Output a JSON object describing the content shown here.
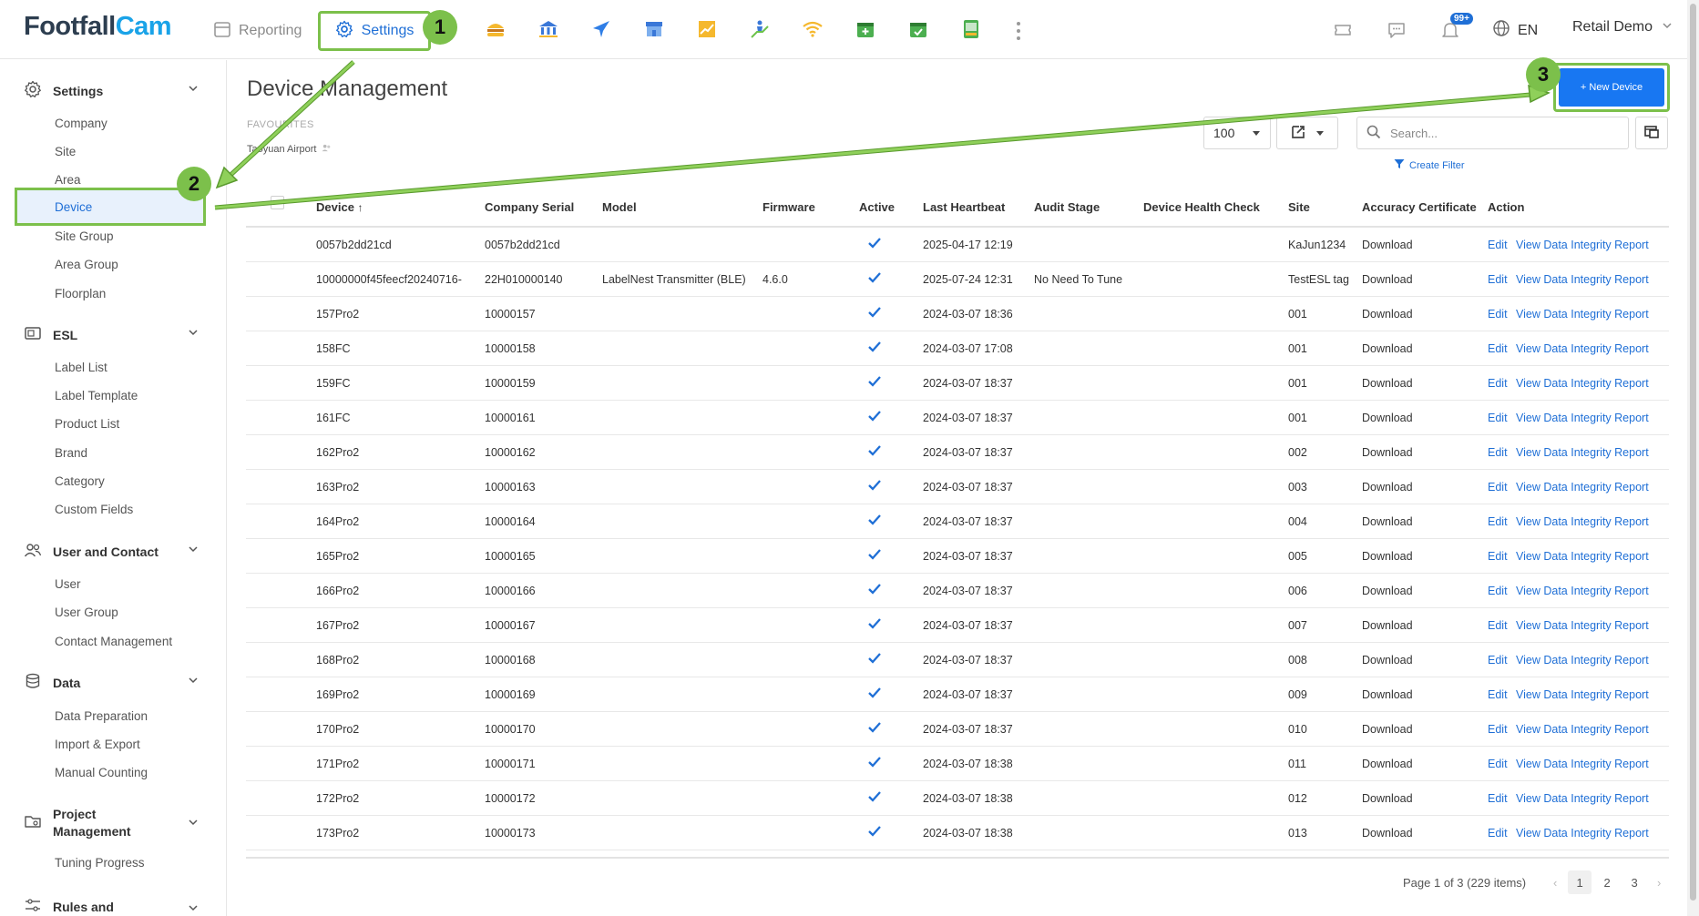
{
  "app": {
    "logo_part1": "Footfall",
    "logo_part2": "Cam"
  },
  "topnav": {
    "reporting_label": "Reporting",
    "settings_label": "Settings",
    "module_icons": [
      "burger-icon",
      "bank-icon",
      "plane-icon",
      "store-icon",
      "growth-chart-icon",
      "escalator-icon",
      "wifi-icon",
      "calendar-add-icon",
      "calendar-check-icon",
      "device-screen-icon"
    ],
    "notification_count": "99+",
    "language": "EN",
    "user_name": "Retail Demo"
  },
  "sidebar": {
    "sections": [
      {
        "label": "Settings",
        "items": [
          "Company",
          "Site",
          "Area",
          "Device",
          "Site Group",
          "Area Group",
          "Floorplan"
        ]
      },
      {
        "label": "ESL",
        "items": [
          "Label List",
          "Label Template",
          "Product List",
          "Brand",
          "Category",
          "Custom Fields"
        ]
      },
      {
        "label": "User and Contact",
        "items": [
          "User",
          "User Group",
          "Contact Management"
        ]
      },
      {
        "label": "Data",
        "items": [
          "Data Preparation",
          "Import & Export",
          "Manual Counting"
        ]
      },
      {
        "label": "Project Management",
        "label_line1": "Project",
        "label_line2": "Management",
        "items": [
          "Tuning Progress"
        ]
      },
      {
        "label": "Rules and",
        "items": []
      }
    ],
    "active_item": "Device"
  },
  "main": {
    "title": "Device Management",
    "favourites_label": "FAVOURITES",
    "favourite_item": "Taoyuan Airport",
    "new_device_label": "+ New Device",
    "page_size": "100",
    "search_placeholder": "Search...",
    "create_filter_label": "Create Filter"
  },
  "table": {
    "columns": [
      "Device",
      "Company Serial",
      "Model",
      "Firmware",
      "Active",
      "Last Heartbeat",
      "Audit Stage",
      "Device Health Check",
      "Site",
      "Accuracy Certificate",
      "Action"
    ],
    "sort_indicator": "↑",
    "download_label": "Download",
    "edit_label": "Edit",
    "report_label": "View Data Integrity Report",
    "rows": [
      {
        "device": "0057b2dd21cd",
        "serial": "0057b2dd21cd",
        "model": "",
        "firmware": "",
        "active": true,
        "heartbeat": "2025-04-17 12:19",
        "audit": "",
        "health": "",
        "site": "KaJun1234"
      },
      {
        "device": "10000000f45feecf20240716-",
        "serial": "22H010000140",
        "model": "LabelNest Transmitter (BLE)",
        "firmware": "4.6.0",
        "active": true,
        "heartbeat": "2025-07-24 12:31",
        "audit": "No Need To Tune",
        "health": "",
        "site": "TestESL tag"
      },
      {
        "device": "157Pro2",
        "serial": "10000157",
        "model": "",
        "firmware": "",
        "active": true,
        "heartbeat": "2024-03-07 18:36",
        "audit": "",
        "health": "",
        "site": "001"
      },
      {
        "device": "158FC",
        "serial": "10000158",
        "model": "",
        "firmware": "",
        "active": true,
        "heartbeat": "2024-03-07 17:08",
        "audit": "",
        "health": "",
        "site": "001"
      },
      {
        "device": "159FC",
        "serial": "10000159",
        "model": "",
        "firmware": "",
        "active": true,
        "heartbeat": "2024-03-07 18:37",
        "audit": "",
        "health": "",
        "site": "001"
      },
      {
        "device": "161FC",
        "serial": "10000161",
        "model": "",
        "firmware": "",
        "active": true,
        "heartbeat": "2024-03-07 18:37",
        "audit": "",
        "health": "",
        "site": "001"
      },
      {
        "device": "162Pro2",
        "serial": "10000162",
        "model": "",
        "firmware": "",
        "active": true,
        "heartbeat": "2024-03-07 18:37",
        "audit": "",
        "health": "",
        "site": "002"
      },
      {
        "device": "163Pro2",
        "serial": "10000163",
        "model": "",
        "firmware": "",
        "active": true,
        "heartbeat": "2024-03-07 18:37",
        "audit": "",
        "health": "",
        "site": "003"
      },
      {
        "device": "164Pro2",
        "serial": "10000164",
        "model": "",
        "firmware": "",
        "active": true,
        "heartbeat": "2024-03-07 18:37",
        "audit": "",
        "health": "",
        "site": "004"
      },
      {
        "device": "165Pro2",
        "serial": "10000165",
        "model": "",
        "firmware": "",
        "active": true,
        "heartbeat": "2024-03-07 18:37",
        "audit": "",
        "health": "",
        "site": "005"
      },
      {
        "device": "166Pro2",
        "serial": "10000166",
        "model": "",
        "firmware": "",
        "active": true,
        "heartbeat": "2024-03-07 18:37",
        "audit": "",
        "health": "",
        "site": "006"
      },
      {
        "device": "167Pro2",
        "serial": "10000167",
        "model": "",
        "firmware": "",
        "active": true,
        "heartbeat": "2024-03-07 18:37",
        "audit": "",
        "health": "",
        "site": "007"
      },
      {
        "device": "168Pro2",
        "serial": "10000168",
        "model": "",
        "firmware": "",
        "active": true,
        "heartbeat": "2024-03-07 18:37",
        "audit": "",
        "health": "",
        "site": "008"
      },
      {
        "device": "169Pro2",
        "serial": "10000169",
        "model": "",
        "firmware": "",
        "active": true,
        "heartbeat": "2024-03-07 18:37",
        "audit": "",
        "health": "",
        "site": "009"
      },
      {
        "device": "170Pro2",
        "serial": "10000170",
        "model": "",
        "firmware": "",
        "active": true,
        "heartbeat": "2024-03-07 18:37",
        "audit": "",
        "health": "",
        "site": "010"
      },
      {
        "device": "171Pro2",
        "serial": "10000171",
        "model": "",
        "firmware": "",
        "active": true,
        "heartbeat": "2024-03-07 18:38",
        "audit": "",
        "health": "",
        "site": "011"
      },
      {
        "device": "172Pro2",
        "serial": "10000172",
        "model": "",
        "firmware": "",
        "active": true,
        "heartbeat": "2024-03-07 18:38",
        "audit": "",
        "health": "",
        "site": "012"
      },
      {
        "device": "173Pro2",
        "serial": "10000173",
        "model": "",
        "firmware": "",
        "active": true,
        "heartbeat": "2024-03-07 18:38",
        "audit": "",
        "health": "",
        "site": "013"
      }
    ]
  },
  "pager": {
    "info": "Page 1 of 3 (229 items)",
    "pages": [
      "1",
      "2",
      "3"
    ],
    "current": "1"
  },
  "annotations": {
    "step1": "1",
    "step2": "2",
    "step3": "3"
  },
  "colors": {
    "accent_blue": "#1877f2",
    "highlight_green": "#7cc04b",
    "link_blue": "#1f6fd6"
  }
}
